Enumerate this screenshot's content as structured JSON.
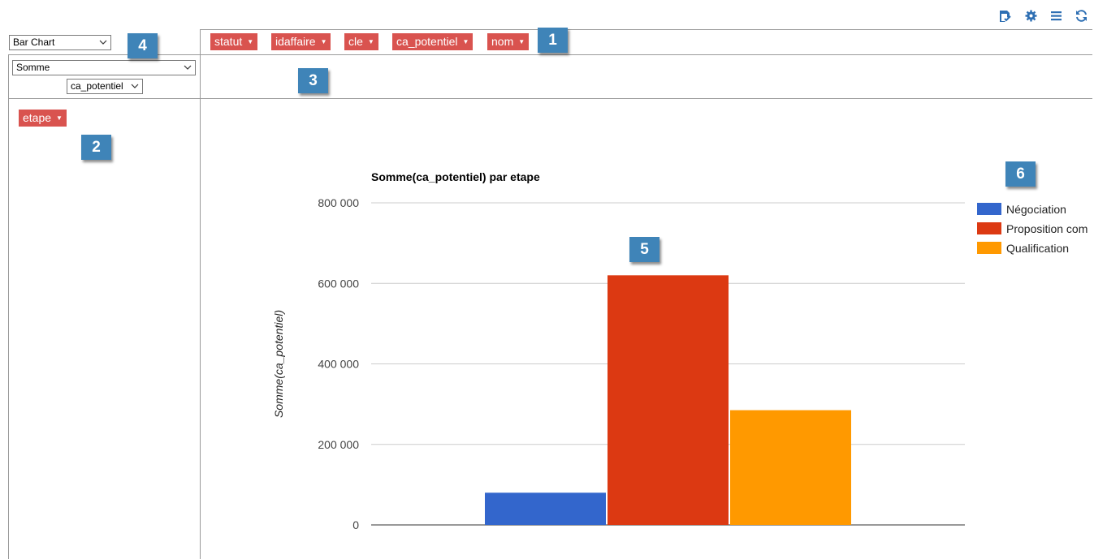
{
  "toolbar": {
    "icons": [
      "save-check-icon",
      "gear-icon",
      "menu-icon",
      "refresh-icon"
    ],
    "accent_color": "#2e6fb3"
  },
  "renderer_select": {
    "value": "Bar Chart"
  },
  "aggregator_select": {
    "value": "Somme"
  },
  "aggregator_field_select": {
    "value": "ca_potentiel"
  },
  "unused_fields": [
    "statut",
    "idaffaire",
    "cle",
    "ca_potentiel",
    "nom"
  ],
  "row_fields": [
    "etape"
  ],
  "callouts": [
    "1",
    "2",
    "3",
    "4",
    "5",
    "6"
  ],
  "colors": {
    "pill": "#d9534f",
    "callout": "#3f84b8"
  },
  "chart_data": {
    "type": "bar",
    "title": "Somme(ca_potentiel) par etape",
    "ylabel": "Somme(ca_potentiel)",
    "xlabel": "",
    "ylim": [
      0,
      800000
    ],
    "yticks": [
      0,
      200000,
      400000,
      600000,
      800000
    ],
    "ytick_labels": [
      "0",
      "200 000",
      "400 000",
      "600 000",
      "800 000"
    ],
    "grid": true,
    "legend_position": "right",
    "series": [
      {
        "name": "Négociation",
        "value": 80000,
        "color": "#3366cc"
      },
      {
        "name": "Proposition com",
        "value": 620000,
        "color": "#dc3912"
      },
      {
        "name": "Qualification",
        "value": 285000,
        "color": "#ff9900"
      }
    ]
  }
}
